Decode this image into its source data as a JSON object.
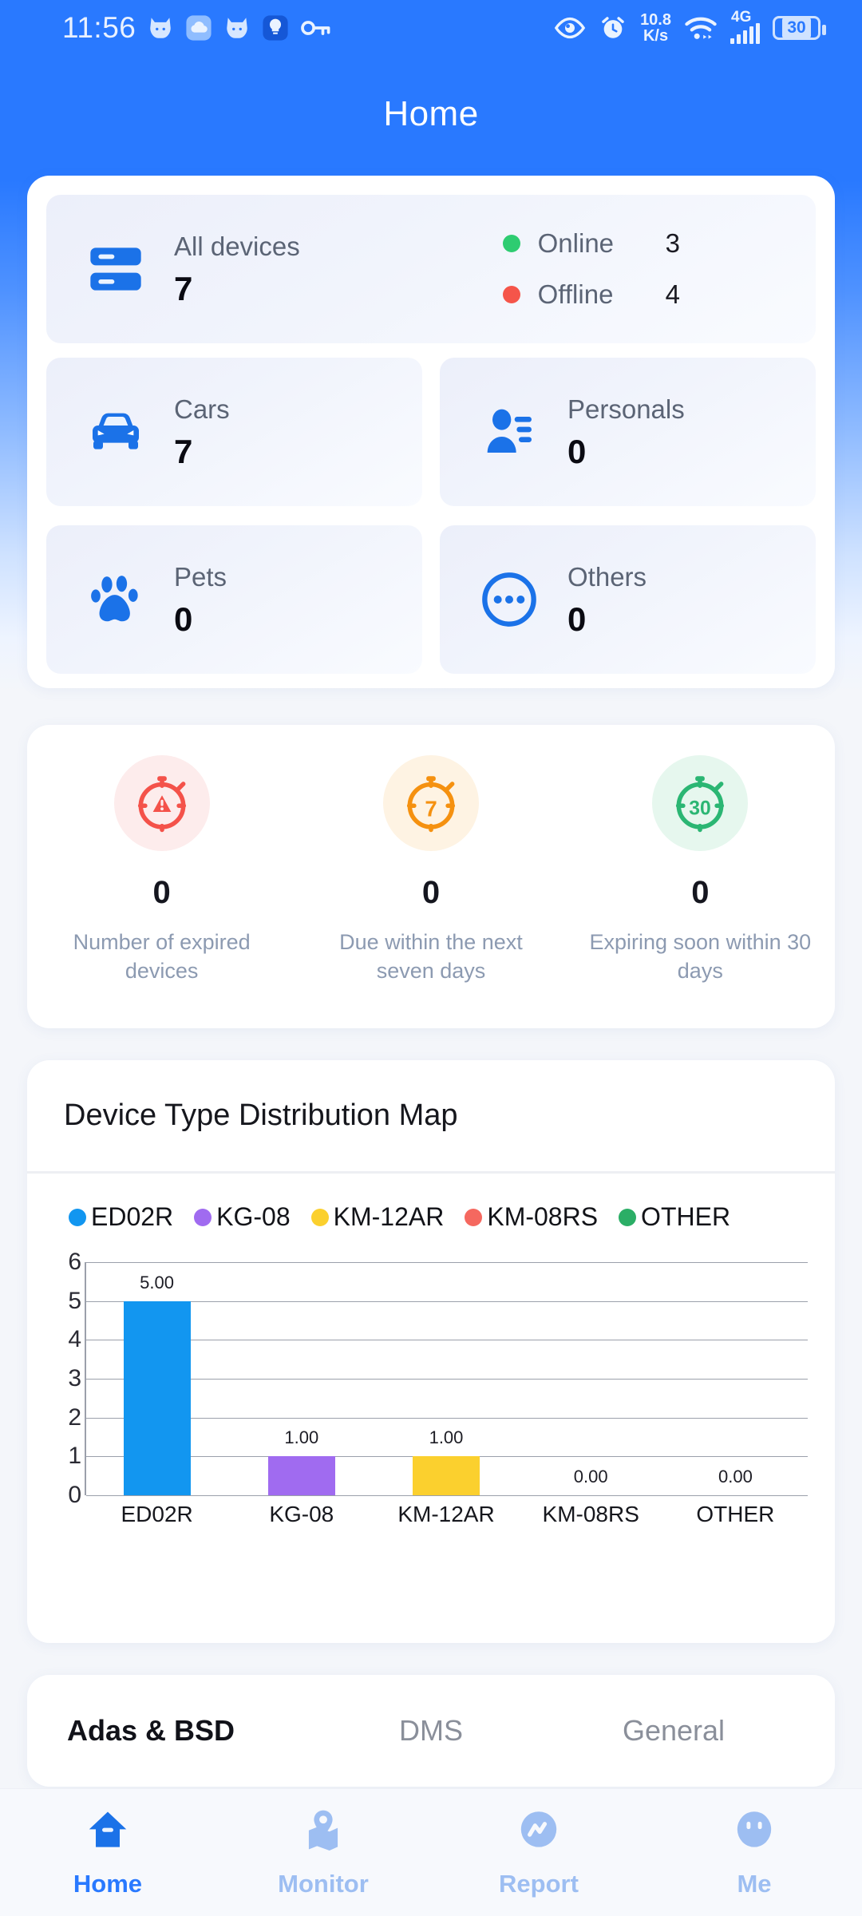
{
  "status_bar": {
    "time": "11:56",
    "left_icons": [
      "cat-icon",
      "cloud-icon",
      "cat-icon",
      "bulb-icon",
      "key-icon"
    ],
    "eye_icon": "eye-icon",
    "alarm_icon": "alarm-clock-icon",
    "net_speed_value": "10.8",
    "net_speed_unit": "K/s",
    "wifi_icon": "wifi-icon",
    "network_type": "4G",
    "signal_icon": "signal-bars-icon",
    "battery_level": "30"
  },
  "header": {
    "title": "Home"
  },
  "devices_card": {
    "all": {
      "icon": "server-stack-icon",
      "label": "All devices",
      "value": "7",
      "statuses": [
        {
          "name": "Online",
          "value": "3",
          "color": "#2ECC71"
        },
        {
          "name": "Offline",
          "value": "4",
          "color": "#F5554A"
        }
      ]
    },
    "categories": [
      {
        "icon": "car-icon",
        "label": "Cars",
        "value": "7"
      },
      {
        "icon": "person-list-icon",
        "label": "Personals",
        "value": "0"
      },
      {
        "icon": "paw-icon",
        "label": "Pets",
        "value": "0"
      },
      {
        "icon": "ellipsis-circle-icon",
        "label": "Others",
        "value": "0"
      }
    ]
  },
  "expiry_card": {
    "items": [
      {
        "icon": "stopwatch-alert-icon",
        "count": "0",
        "caption": "Number of expired devices",
        "color": "#F4524A",
        "bg": "#FDECEC"
      },
      {
        "icon": "stopwatch-7-icon",
        "count": "0",
        "caption": "Due within the next seven days",
        "color": "#F59110",
        "bg": "#FEF3E3"
      },
      {
        "icon": "stopwatch-30-icon",
        "count": "0",
        "caption": "Expiring soon within 30 days",
        "color": "#2BB673",
        "bg": "#E6F7EE"
      }
    ]
  },
  "chart_card": {
    "title": "Device Type Distribution Map"
  },
  "chart_data": {
    "type": "bar",
    "title": "Device Type Distribution Map",
    "categories": [
      "ED02R",
      "KG-08",
      "KM-12AR",
      "KM-08RS",
      "OTHER"
    ],
    "values": [
      5,
      1,
      1,
      0,
      0
    ],
    "value_labels": [
      "5.00",
      "1.00",
      "1.00",
      "0.00",
      "0.00"
    ],
    "colors": [
      "#1296F0",
      "#A06BF0",
      "#FBD02E",
      "#F5685F",
      "#2BAE66"
    ],
    "legend": [
      {
        "label": "ED02R",
        "color": "#1296F0"
      },
      {
        "label": "KG-08",
        "color": "#A06BF0"
      },
      {
        "label": "KM-12AR",
        "color": "#FBD02E"
      },
      {
        "label": "KM-08RS",
        "color": "#F5685F"
      },
      {
        "label": "OTHER",
        "color": "#2BAE66"
      }
    ],
    "ylim": [
      0,
      6
    ],
    "yticks": [
      "0",
      "1",
      "2",
      "3",
      "4",
      "5",
      "6"
    ],
    "xlabel": "",
    "ylabel": "",
    "grid": true,
    "legend_position": "top"
  },
  "segment_tabs": {
    "items": [
      {
        "label": "Adas & BSD",
        "active": true
      },
      {
        "label": "DMS",
        "active": false
      },
      {
        "label": "General",
        "active": false
      }
    ]
  },
  "bottom_nav": {
    "items": [
      {
        "label": "Home",
        "icon": "home-icon",
        "active": true
      },
      {
        "label": "Monitor",
        "icon": "map-pin-icon",
        "active": false
      },
      {
        "label": "Report",
        "icon": "chart-circle-icon",
        "active": false
      },
      {
        "label": "Me",
        "icon": "face-icon",
        "active": false
      }
    ]
  }
}
